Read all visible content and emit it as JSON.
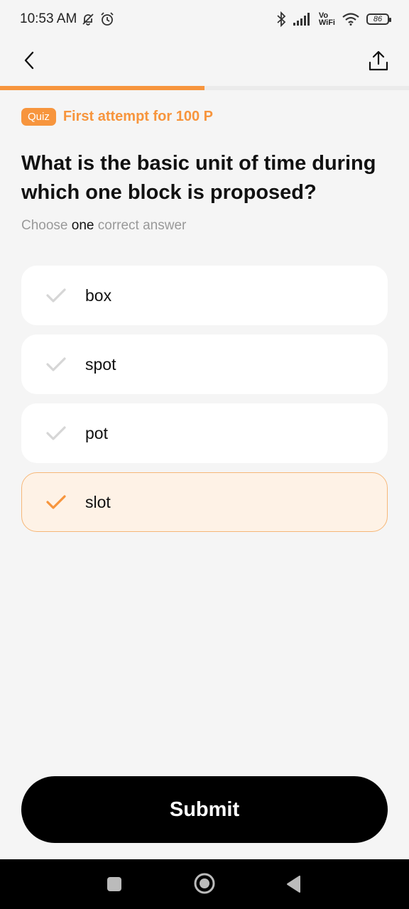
{
  "status": {
    "time": "10:53 AM",
    "vowifi_top": "Vo",
    "vowifi_bottom": "WiFi",
    "battery": "86"
  },
  "progress": {
    "fraction": 0.5
  },
  "quiz": {
    "badge": "Quiz",
    "subtitle": "First attempt for 100 P",
    "question": "What is the basic unit of time during which one block is proposed?",
    "instruction_pre": "Choose",
    "instruction_em": "one",
    "instruction_post": "correct answer",
    "options": [
      {
        "label": "box",
        "selected": false
      },
      {
        "label": "spot",
        "selected": false
      },
      {
        "label": "pot",
        "selected": false
      },
      {
        "label": "slot",
        "selected": true
      }
    ]
  },
  "submit_label": "Submit",
  "colors": {
    "accent": "#f7953d",
    "selected_bg": "#fef2e6",
    "check_inactive": "#d6d6d6"
  }
}
